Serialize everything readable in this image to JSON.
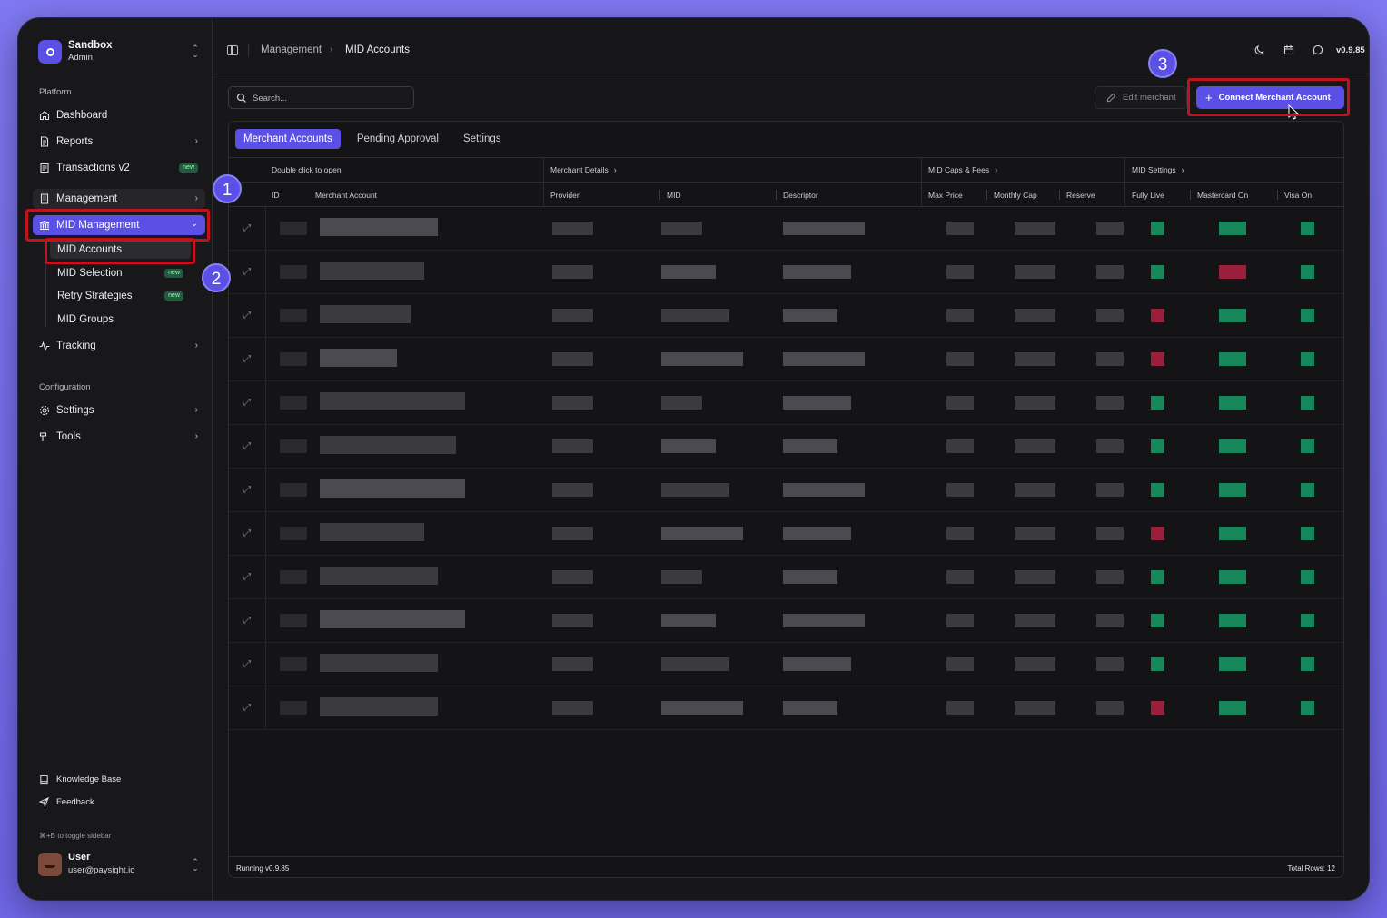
{
  "brand": {
    "name": "Sandbox",
    "role": "Admin"
  },
  "nav": {
    "platform_label": "Platform",
    "dashboard": "Dashboard",
    "reports": "Reports",
    "transactions": "Transactions v2",
    "new_badge": "new",
    "management": "Management",
    "mid_management": "MID Management",
    "mid_accounts": "MID Accounts",
    "mid_selection": "MID Selection",
    "retry_strategies": "Retry Strategies",
    "mid_groups": "MID Groups",
    "tracking": "Tracking",
    "configuration_label": "Configuration",
    "settings": "Settings",
    "tools": "Tools"
  },
  "footer": {
    "knowledge_base": "Knowledge Base",
    "feedback": "Feedback",
    "toggle_hint": "⌘+B to toggle sidebar"
  },
  "user": {
    "name": "User",
    "email": "user@paysight.io"
  },
  "steps": [
    "1",
    "2",
    "3"
  ],
  "header": {
    "breadcrumb_parent": "Management",
    "breadcrumb_current": "MID Accounts",
    "version": "v0.9.85"
  },
  "toolbar": {
    "search_placeholder": "Search...",
    "edit_label": "Edit merchant",
    "connect_label": "Connect Merchant Account"
  },
  "tabs": [
    "Merchant Accounts",
    "Pending Approval",
    "Settings"
  ],
  "table": {
    "hint": "Double click to open",
    "groups": [
      "Merchant Details",
      "MID Caps & Fees",
      "MID Settings"
    ],
    "columns": [
      "ID",
      "Merchant Account",
      "Provider",
      "MID",
      "Descriptor",
      "Max Price",
      "Monthly Cap",
      "Reserve",
      "Fully Live",
      "Mastercard On",
      "Visa On"
    ],
    "row_count": 12,
    "fully_live": [
      "green",
      "green",
      "red",
      "red",
      "green",
      "green",
      "green",
      "red",
      "green",
      "green",
      "green",
      "red"
    ],
    "mastercard_on": [
      "green",
      "red",
      "green",
      "green",
      "green",
      "green",
      "green",
      "green",
      "green",
      "green",
      "green",
      "green"
    ]
  },
  "status": {
    "running": "Running v0.9.85",
    "total_rows": "Total Rows: 12"
  },
  "colors": {
    "accent": "#5b50e6",
    "highlight": "#c1121f",
    "on": "#16875a",
    "off": "#9b1e3a"
  }
}
